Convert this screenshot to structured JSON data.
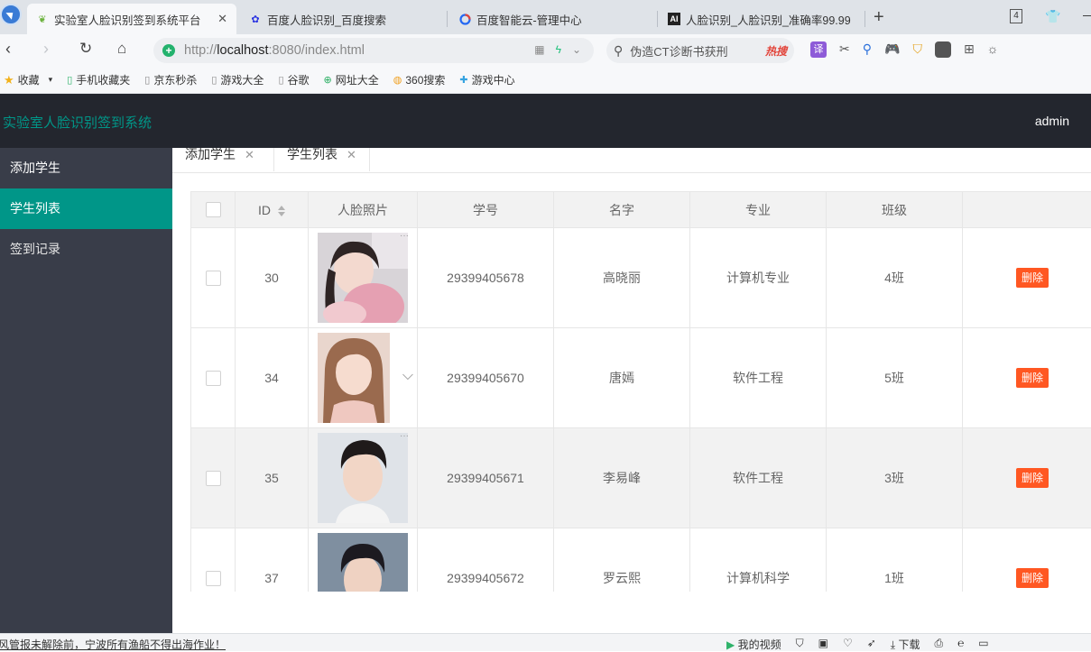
{
  "browser": {
    "tabs": [
      {
        "title": "实验室人脸识别签到系统平台",
        "active": true
      },
      {
        "title": "百度人脸识别_百度搜索",
        "active": false
      },
      {
        "title": "百度智能云-管理中心",
        "active": false
      },
      {
        "title": "人脸识别_人脸识别_准确率99.99",
        "active": false
      }
    ],
    "tab_count": "4",
    "url_prefix": "http://",
    "url_host": "localhost",
    "url_rest": ":8080/index.html",
    "search_text": "伪造CT诊断书获刑",
    "search_hot": "热搜",
    "bookmarks": [
      "收藏",
      "手机收藏夹",
      "京东秒杀",
      "游戏大全",
      "谷歌",
      "网址大全",
      "360搜索",
      "游戏中心"
    ],
    "translate_label": "译"
  },
  "app": {
    "logo": "实验室人脸识别签到系统",
    "user": "admin",
    "sidebar": [
      {
        "label": "添加学生"
      },
      {
        "label": "学生列表"
      },
      {
        "label": "签到记录"
      }
    ],
    "tabs": [
      {
        "label": "添加学生"
      },
      {
        "label": "学生列表"
      }
    ],
    "table": {
      "headers": [
        "ID",
        "人脸照片",
        "学号",
        "名字",
        "专业",
        "班级"
      ],
      "rows": [
        {
          "id": "30",
          "student_no": "29399405678",
          "name": "高晓丽",
          "major": "计算机专业",
          "class": "4班"
        },
        {
          "id": "34",
          "student_no": "29399405670",
          "name": "唐嫣",
          "major": "软件工程",
          "class": "5班"
        },
        {
          "id": "35",
          "student_no": "29399405671",
          "name": "李易峰",
          "major": "软件工程",
          "class": "3班"
        },
        {
          "id": "37",
          "student_no": "29399405672",
          "name": "罗云熙",
          "major": "计算机科学",
          "class": "1班"
        }
      ],
      "delete_label": "删除"
    }
  },
  "statusbar": {
    "news": "风管报未解除前，宁波所有渔船不得出海作业！",
    "my_video": "我的视频",
    "download": "下载"
  },
  "colors": {
    "header_bg": "#23262e",
    "sidebar_bg": "#393d49",
    "accent": "#009688",
    "danger": "#ff5722"
  }
}
